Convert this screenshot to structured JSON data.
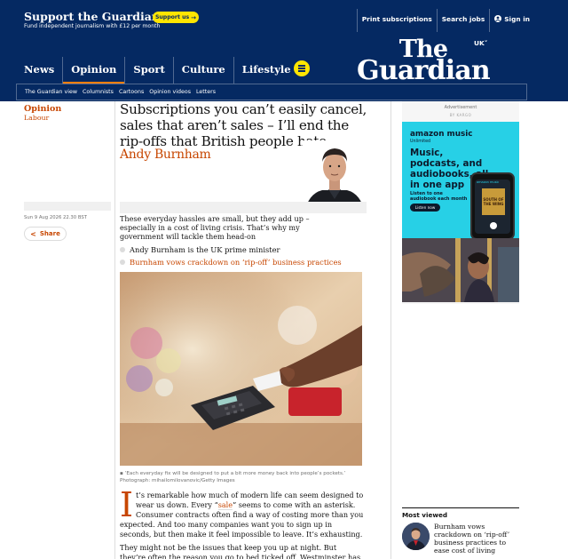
{
  "support": {
    "title": "Support the Guardian",
    "subtitle": "Fund independent journalism with £12 per month",
    "button_label": "Support us",
    "links": [
      "Print subscriptions",
      "Search jobs",
      "Sign in"
    ]
  },
  "masthead": {
    "edition": "UK",
    "logo_line1": "The",
    "logo_line2": "Guardian",
    "pillars": [
      "News",
      "Opinion",
      "Sport",
      "Culture",
      "Lifestyle"
    ],
    "active_pillar": "Opinion",
    "subnav": [
      "The Guardian view",
      "Columnists",
      "Cartoons",
      "Opinion videos",
      "Letters"
    ]
  },
  "article": {
    "section": "Opinion",
    "series": "Labour",
    "headline": "Subscriptions you can’t easily cancel, sales that aren’t sales – I’ll end the rip-offs that British people hate",
    "byline": "Andy Burnham",
    "dateline": "Sun 9 Aug 2026 22.30 BST",
    "share_label": "Share",
    "standfirst": "These everyday hassles are small, but they add up – especially in a cost of living crisis. That’s why my government will tackle them head-on",
    "bullets": [
      {
        "text": "Andy Burnham is the UK prime minister",
        "is_link": false
      },
      {
        "text": "Burnham vows crackdown on ‘rip-off’ business practices",
        "is_link": true
      }
    ],
    "caption": "‘Each everyday fix will be designed to put a bit more money back into people’s pockets.’ Photograph: mihailomilovanovic/Getty Images",
    "body": {
      "dropcap": "I",
      "p1_before": "t’s remarkable how much of modern life can seem designed to wear us down. Every “",
      "p1_link": "sale",
      "p1_after": "” seems to come with an asterisk. Consumer contracts often find a way of costing more than you expected. And too many companies want you to sign up in seconds, but then make it feel impossible to leave. It’s exhausting.",
      "p2": "They might not be the issues that keep you up at night. But they’re often the reason you go to bed ticked off. Westminster has got used to telling people"
    }
  },
  "ad": {
    "label": "Advertisement",
    "vendor": "BY KARGO",
    "brand": "amazon music",
    "unlimited": "Unlimited",
    "headline": "Music, podcasts, and audiobooks, all in one app",
    "small_text": "Listen to one audiobook each month",
    "cta": "Listen now",
    "phone_label": "amazon music",
    "book_title": "SOUTH OF THE WING"
  },
  "most_viewed": {
    "title": "Most viewed",
    "items": [
      {
        "text": "Burnham vows crackdown on ‘rip-off’ business practices to ease cost of living"
      }
    ]
  },
  "colors": {
    "brand_blue": "#052962",
    "opinion_orange": "#c74600",
    "support_yellow": "#ffe500",
    "active_underline": "#ff7f0f"
  }
}
